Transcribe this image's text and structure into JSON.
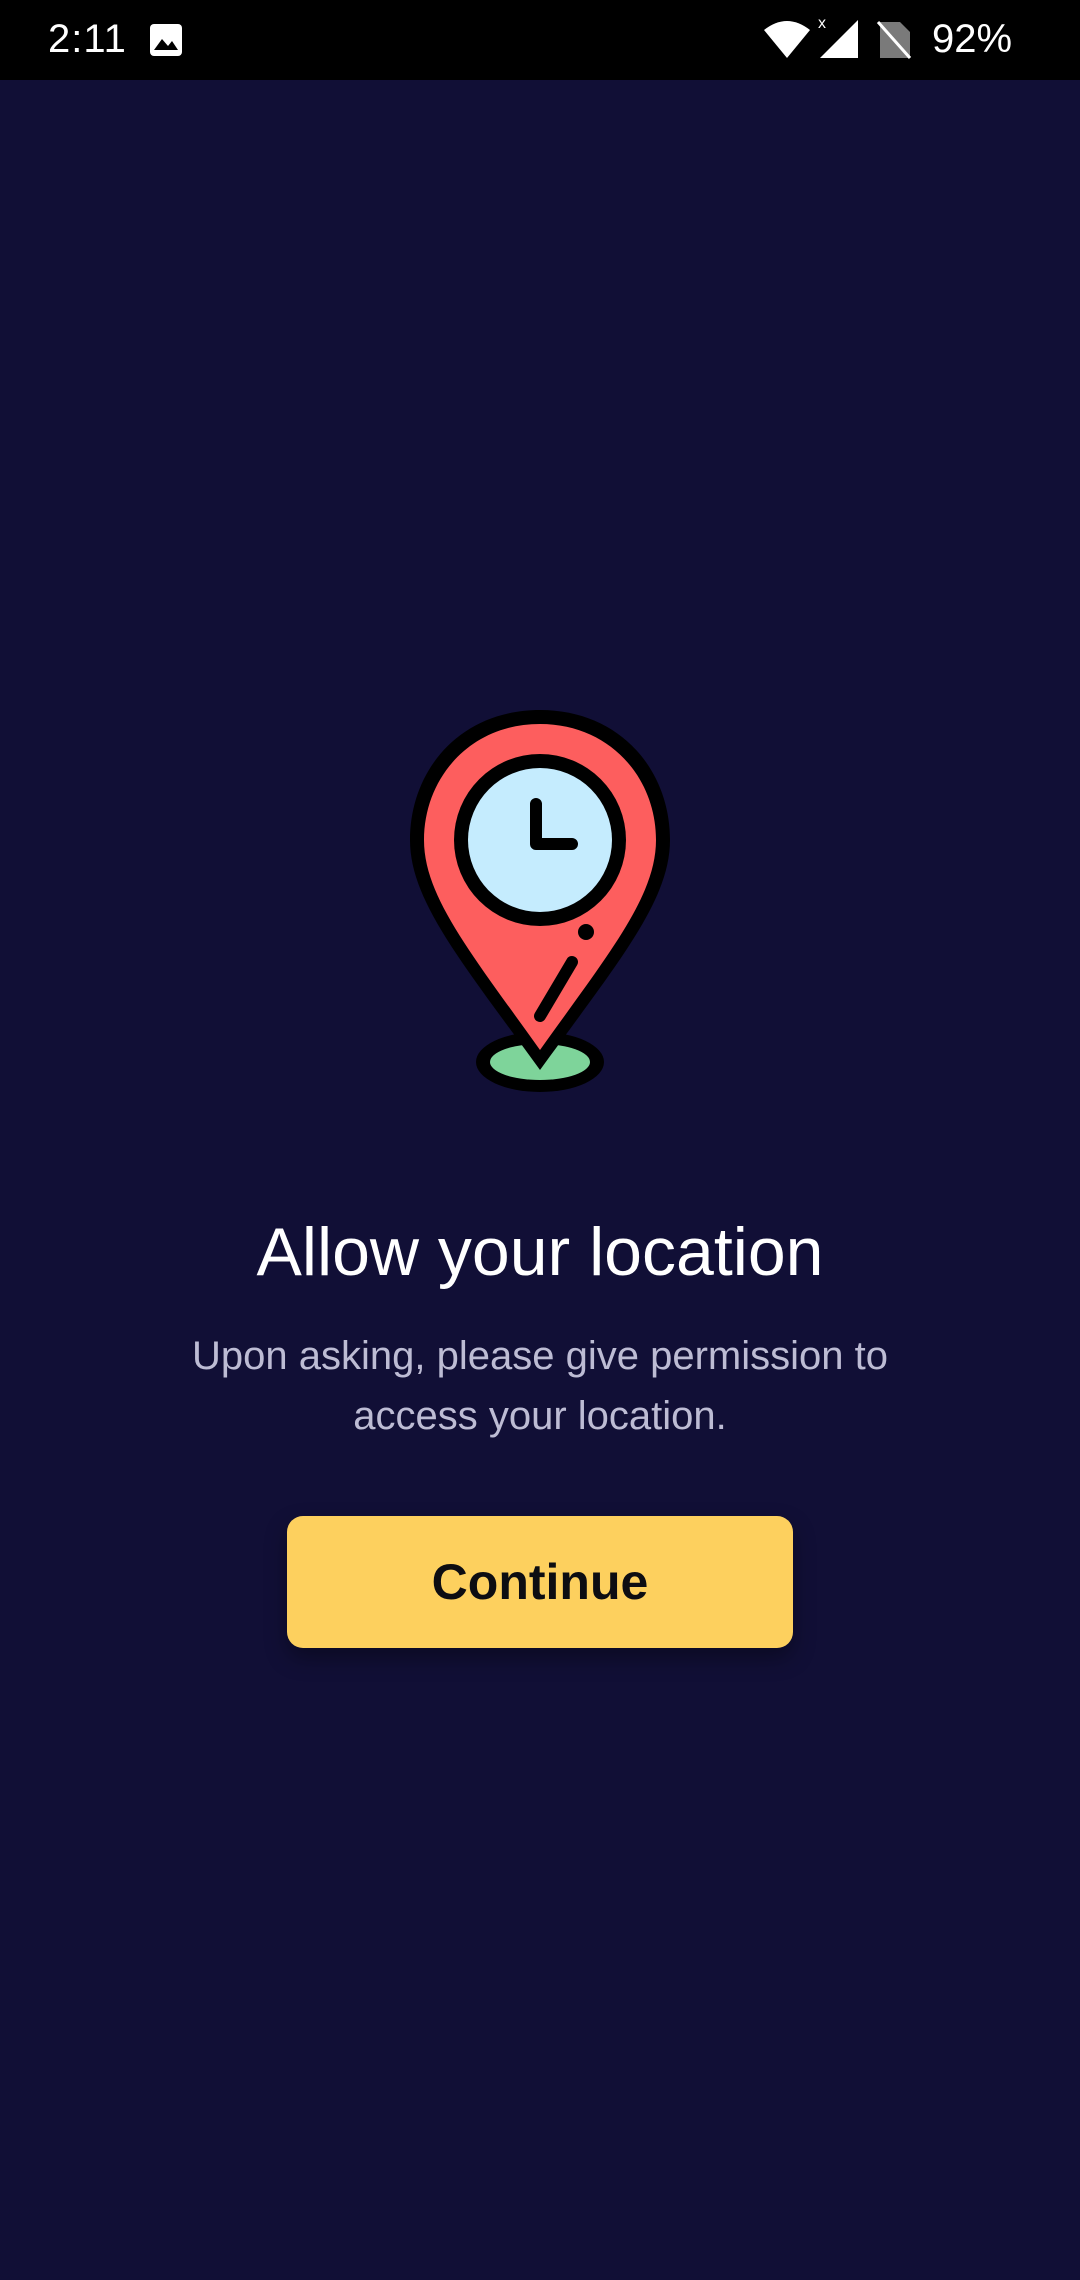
{
  "status_bar": {
    "time": "2:11",
    "battery": "92%",
    "icons": [
      "image-icon",
      "wifi-icon",
      "signal-icon",
      "no-sim-icon"
    ]
  },
  "illustration": {
    "icon": "location-pin-clock-icon",
    "colors": {
      "pin": "#fd5e5e",
      "clock_face": "#c5ecfe",
      "base": "#7ed49a",
      "outline": "#000000"
    }
  },
  "content": {
    "title": "Allow your location",
    "subtitle": "Upon asking, please give permission to access your location.",
    "continue_label": "Continue"
  },
  "colors": {
    "background": "#110f36",
    "button": "#fdd05e",
    "subtitle_text": "#bdbcd4"
  }
}
